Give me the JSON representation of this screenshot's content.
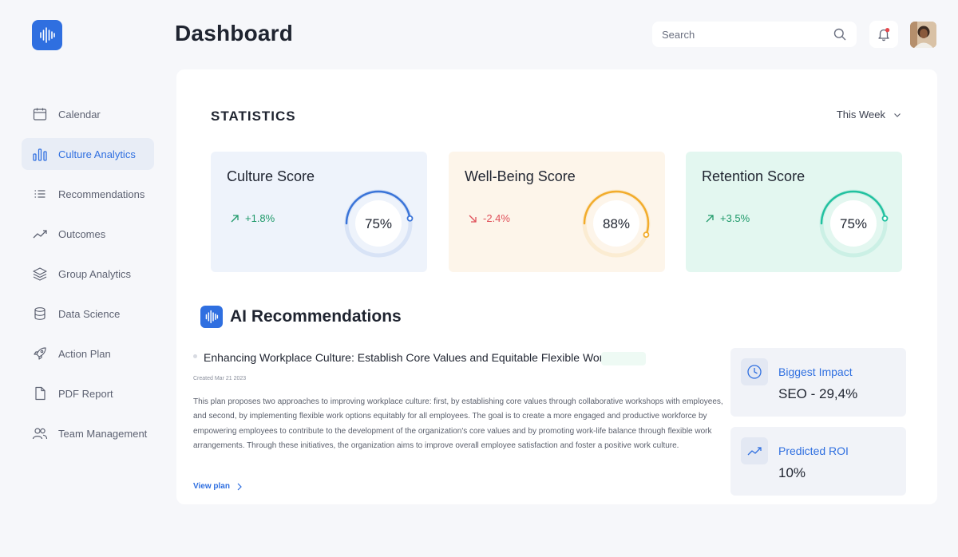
{
  "header": {
    "title": "Dashboard",
    "search_placeholder": "Search"
  },
  "sidebar": {
    "items": [
      {
        "label": "Calendar",
        "icon": "calendar-icon"
      },
      {
        "label": "Culture Analytics",
        "icon": "bar-chart-icon",
        "active": true
      },
      {
        "label": "Recommendations",
        "icon": "list-icon"
      },
      {
        "label": "Outcomes",
        "icon": "trend-line-icon"
      },
      {
        "label": "Group Analytics",
        "icon": "layers-icon"
      },
      {
        "label": "Data Science",
        "icon": "database-icon"
      },
      {
        "label": "Action Plan",
        "icon": "rocket-icon"
      },
      {
        "label": "PDF Report",
        "icon": "file-icon"
      },
      {
        "label": "Team Management",
        "icon": "users-icon"
      }
    ]
  },
  "statistics": {
    "title": "STATISTICS",
    "period": "This Week",
    "cards": [
      {
        "title": "Culture Score",
        "delta": "+1.8%",
        "direction": "up",
        "value_label": "75%",
        "value": 75,
        "color": "#3a74d8"
      },
      {
        "title": "Well-Being Score",
        "delta": "-2.4%",
        "direction": "down",
        "value_label": "88%",
        "value": 88,
        "color": "#f2ac2c"
      },
      {
        "title": "Retention Score",
        "delta": "+3.5%",
        "direction": "up",
        "value_label": "75%",
        "value": 75,
        "color": "#22c1a0"
      }
    ]
  },
  "ai": {
    "title": "AI Recommendations",
    "rec_title": "Enhancing Workplace Culture: Establish Core Values and Equitable Flexible Work",
    "rec_date": "Created Mar 21 2023",
    "rec_body": "This plan proposes two approaches to improving workplace culture: first, by establishing core values through collaborative workshops with employees, and second, by implementing flexible work options equitably for all employees. The goal is to create a more engaged and productive workforce by empowering employees to contribute to the development of the organization's core values and by promoting work-life balance through flexible work arrangements. Through these initiatives, the organization aims to improve overall employee satisfaction and foster a positive work culture.",
    "view_plan": "View plan",
    "biggest_impact_label": "Biggest Impact",
    "biggest_impact_value": "SEO - 29,4%",
    "predicted_roi_label": "Predicted ROI",
    "predicted_roi_value": "10%"
  }
}
